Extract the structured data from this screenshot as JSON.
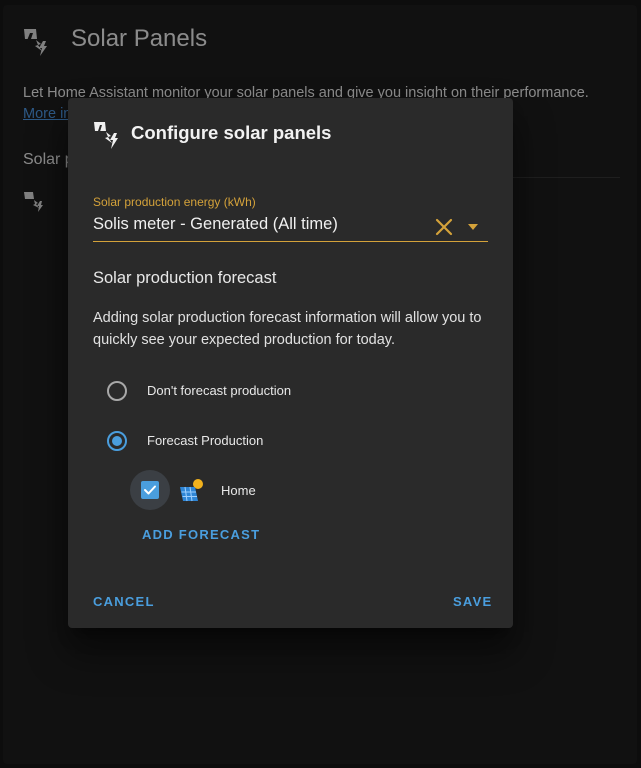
{
  "page": {
    "title": "Solar Panels",
    "description": "Let Home Assistant monitor your solar panels and give you insight on their performance.",
    "link_text": "More in",
    "section_label": "Solar p"
  },
  "dialog": {
    "title": "Configure solar panels",
    "energy_field": {
      "label": "Solar production energy (kWh)",
      "value": "Solis meter - Generated (All time)"
    },
    "forecast_heading": "Solar production forecast",
    "forecast_description": "Adding solar production forecast information will allow you to quickly see your expected production for today.",
    "options": [
      {
        "label": "Don't forecast production",
        "checked": false
      },
      {
        "label": "Forecast Production",
        "checked": true
      }
    ],
    "forecast_entries": [
      {
        "label": "Home",
        "checked": true,
        "icon": "solar-panel-sun-icon"
      }
    ],
    "add_forecast_label": "ADD FORECAST",
    "cancel_label": "CANCEL",
    "save_label": "SAVE"
  },
  "colors": {
    "accent": "#4a9ede",
    "field_accent": "#d4a23a",
    "dialog_bg": "#2a2a2a",
    "page_bg": "#1c1c1c"
  },
  "icons": {
    "title_icon": "solar-power-icon",
    "clear_icon": "close-icon",
    "dropdown_icon": "menu-down-icon"
  }
}
